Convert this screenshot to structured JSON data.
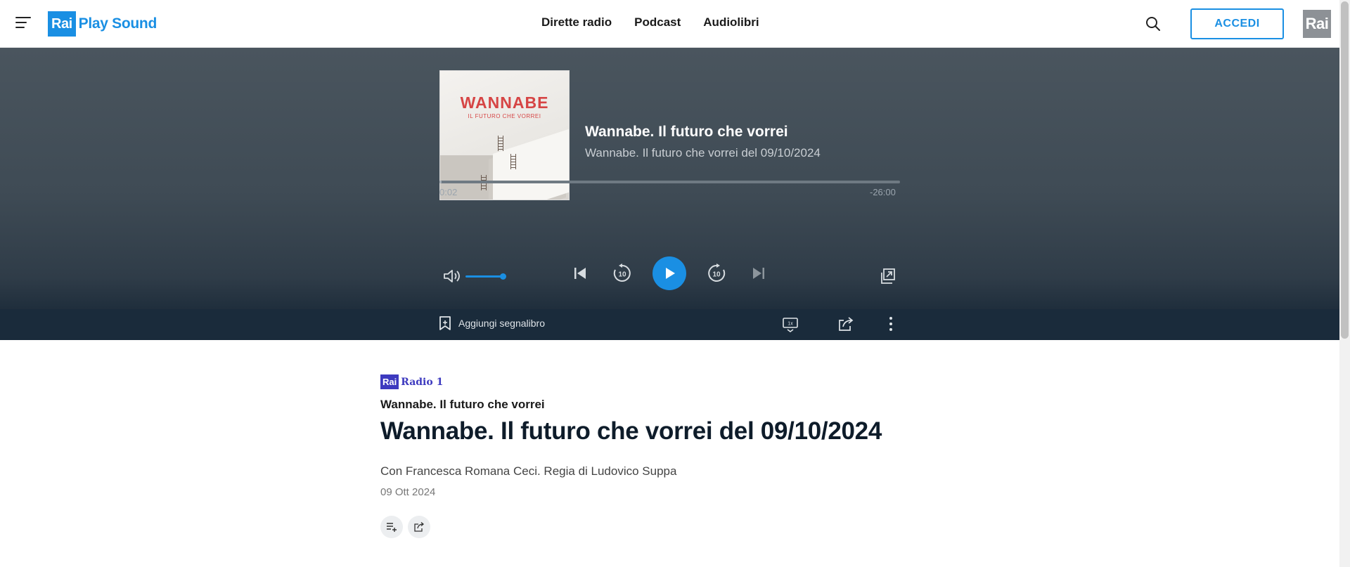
{
  "header": {
    "logo_rai": "Rai",
    "logo_text": "Play Sound",
    "nav": [
      "Dirette radio",
      "Podcast",
      "Audiolibri"
    ],
    "login_label": "ACCEDI",
    "rai_badge": "Rai"
  },
  "player": {
    "cover_title": "WANNABE",
    "cover_subtitle": "IL FUTURO CHE VORREI",
    "episode_title": "Wannabe. Il futuro che vorrei",
    "episode_subtitle": "Wannabe. Il futuro che vorrei del 09/10/2024",
    "elapsed": "0:02",
    "remaining": "-26:00",
    "progress_fraction": 0.0013,
    "volume_fraction": 1.0,
    "bookmark_label": "Aggiungi segnalibro",
    "speed_label": "1x"
  },
  "content": {
    "channel_rai": "Rai",
    "channel_name": "Radio 1",
    "program_name": "Wannabe. Il futuro che vorrei",
    "title": "Wannabe. Il futuro che vorrei del 09/10/2024",
    "description": "Con Francesca Romana Ceci. Regia di Ludovico Suppa",
    "date": "09 Ott 2024"
  },
  "colors": {
    "accent": "#1a8fe3",
    "channel": "#3d3abf",
    "player_bg": "#434f59",
    "bar_bg": "#1a2b3b"
  },
  "icons": [
    "menu-icon",
    "search-icon",
    "volume-icon",
    "skip-previous-icon",
    "rewind-10-icon",
    "play-icon",
    "forward-10-icon",
    "skip-next-icon",
    "popout-icon",
    "bookmark-icon",
    "speed-icon",
    "share-icon",
    "more-icon",
    "add-to-playlist-icon"
  ]
}
